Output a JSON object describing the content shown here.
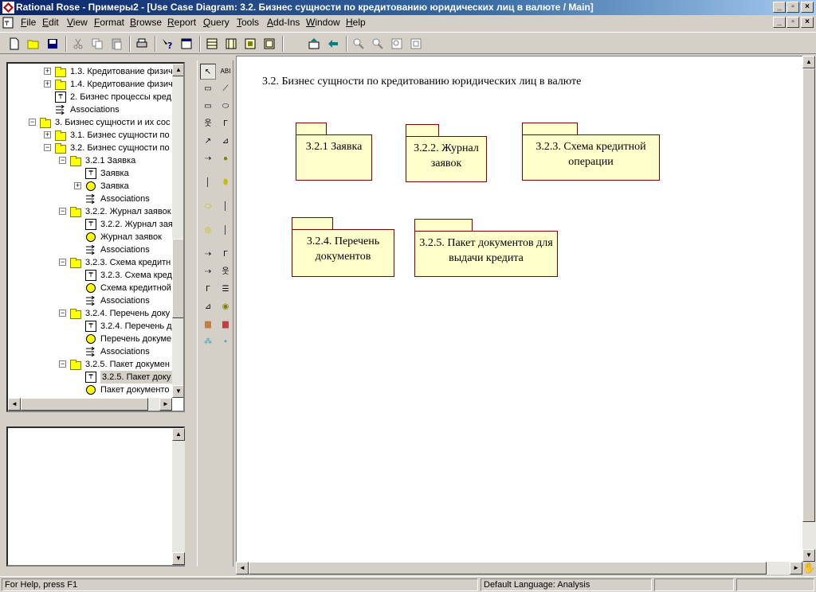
{
  "window": {
    "title": "Rational Rose - Примеры2 - [Use Case Diagram: 3.2. Бизнес сущности по кредитованию юридических лиц в валюте / Main]"
  },
  "menu": [
    "File",
    "Edit",
    "View",
    "Format",
    "Browse",
    "Report",
    "Query",
    "Tools",
    "Add-Ins",
    "Window",
    "Help"
  ],
  "toolbar": {
    "buttons": [
      "new-icon",
      "open-icon",
      "save-icon",
      "cut-icon",
      "copy-icon",
      "paste-icon",
      "print-icon",
      "context-help-icon",
      "view-doc-icon",
      "browse-class-icon",
      "browse-interaction-icon",
      "browse-component-icon",
      "browse-deployment-icon",
      "browse-parent-icon",
      "browse-previous-icon",
      "zoom-in-icon",
      "zoom-out-icon",
      "fit-window-icon",
      "undo-fit-icon"
    ]
  },
  "tree": [
    {
      "label": "1.3. Кредитование физич",
      "indent": 3,
      "type": "folder",
      "exp": "+"
    },
    {
      "label": "1.4. Кредитование физич",
      "indent": 3,
      "type": "folder",
      "exp": "+"
    },
    {
      "label": "2. Бизнес процессы кред",
      "indent": 3,
      "type": "diagram",
      "exp": ""
    },
    {
      "label": "Associations",
      "indent": 3,
      "type": "assoc",
      "exp": ""
    },
    {
      "label": "3. Бизнес сущности и их сос",
      "indent": 2,
      "type": "folder",
      "exp": "-"
    },
    {
      "label": "3.1. Бизнес сущности по",
      "indent": 3,
      "type": "folder",
      "exp": "+"
    },
    {
      "label": "3.2. Бизнес сущности по",
      "indent": 3,
      "type": "folder",
      "exp": "-"
    },
    {
      "label": "3.2.1 Заявка",
      "indent": 4,
      "type": "folder",
      "exp": "-"
    },
    {
      "label": "Заявка",
      "indent": 5,
      "type": "diagram",
      "exp": ""
    },
    {
      "label": "Заявка",
      "indent": 5,
      "type": "circle",
      "exp": "+"
    },
    {
      "label": "Associations",
      "indent": 5,
      "type": "assoc",
      "exp": ""
    },
    {
      "label": "3.2.2. Журнал заявок",
      "indent": 4,
      "type": "folder",
      "exp": "-"
    },
    {
      "label": "3.2.2. Журнал зая",
      "indent": 5,
      "type": "diagram",
      "exp": ""
    },
    {
      "label": "Журнал заявок",
      "indent": 5,
      "type": "circle",
      "exp": ""
    },
    {
      "label": "Associations",
      "indent": 5,
      "type": "assoc",
      "exp": ""
    },
    {
      "label": "3.2.3. Схема кредитн",
      "indent": 4,
      "type": "folder",
      "exp": "-"
    },
    {
      "label": "3.2.3. Схема кред",
      "indent": 5,
      "type": "diagram",
      "exp": ""
    },
    {
      "label": "Схема кредитной",
      "indent": 5,
      "type": "circle",
      "exp": ""
    },
    {
      "label": "Associations",
      "indent": 5,
      "type": "assoc",
      "exp": ""
    },
    {
      "label": "3.2.4. Перечень доку",
      "indent": 4,
      "type": "folder",
      "exp": "-"
    },
    {
      "label": "3.2.4. Перечень д",
      "indent": 5,
      "type": "diagram",
      "exp": ""
    },
    {
      "label": "Перечень докуме",
      "indent": 5,
      "type": "circle",
      "exp": ""
    },
    {
      "label": "Associations",
      "indent": 5,
      "type": "assoc",
      "exp": ""
    },
    {
      "label": "3.2.5. Пакет докумен",
      "indent": 4,
      "type": "folder",
      "exp": "-"
    },
    {
      "label": "3.2.5. Пакет доку",
      "indent": 5,
      "type": "diagram",
      "exp": "",
      "selected": true
    },
    {
      "label": "Пакет документо",
      "indent": 5,
      "type": "circle",
      "exp": ""
    }
  ],
  "diagram": {
    "title": "3.2. Бизнес сущности по кредитованию юридических лиц в валюте",
    "packages": [
      {
        "name": "3.2.1 Заявка"
      },
      {
        "name": "3.2.2. Журнал заявок"
      },
      {
        "name": "3.2.3. Схема кредитной операции"
      },
      {
        "name": "3.2.4. Перечень документов"
      },
      {
        "name": "3.2.5. Пакет документов для выдачи кредита"
      }
    ]
  },
  "status": {
    "help": "For Help, press F1",
    "language": "Default Language: Analysis"
  }
}
